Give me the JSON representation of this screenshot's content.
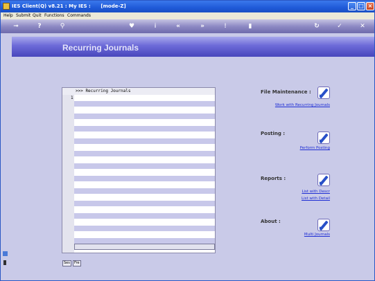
{
  "window": {
    "title": "IES Client(Q) v8.21 : My IES :      [mode-Z]",
    "min_glyph": "_",
    "max_glyph": "□",
    "close_glyph": "×"
  },
  "menu": [
    "Help",
    "Submit",
    "Quit",
    "Functions",
    "Commands"
  ],
  "toolbar_glyphs": {
    "key": "⊸",
    "help": "?",
    "search": "⚲",
    "heart": "♥",
    "info": "i",
    "back": "«",
    "forward": "»",
    "mark": "!",
    "doc": "▮",
    "refresh": "↻",
    "ok": "✓",
    "cancel": "✕"
  },
  "page": {
    "title": "Recurring Journals"
  },
  "grid": {
    "header": ">>> Recurring Journals",
    "row_number": "1",
    "stripe_count": 12
  },
  "tabs": [
    "Ses",
    "Fre"
  ],
  "sections": [
    {
      "key": "file_maintenance",
      "label": "File Maintenance :",
      "links": [
        "Work with Recurring Journals"
      ]
    },
    {
      "key": "posting",
      "label": "Posting :",
      "links": [
        "Perform Posting"
      ]
    },
    {
      "key": "reports",
      "label": "Reports :",
      "links": [
        "List with Descr",
        "List with Detail"
      ]
    },
    {
      "key": "about",
      "label": "About :",
      "links": [
        "Multi Journals"
      ]
    }
  ],
  "colors": {
    "titlebar": "#1f5ad8",
    "background": "#c9cae8",
    "header_band": "#6c6ad8",
    "link": "#1c2cd4"
  }
}
